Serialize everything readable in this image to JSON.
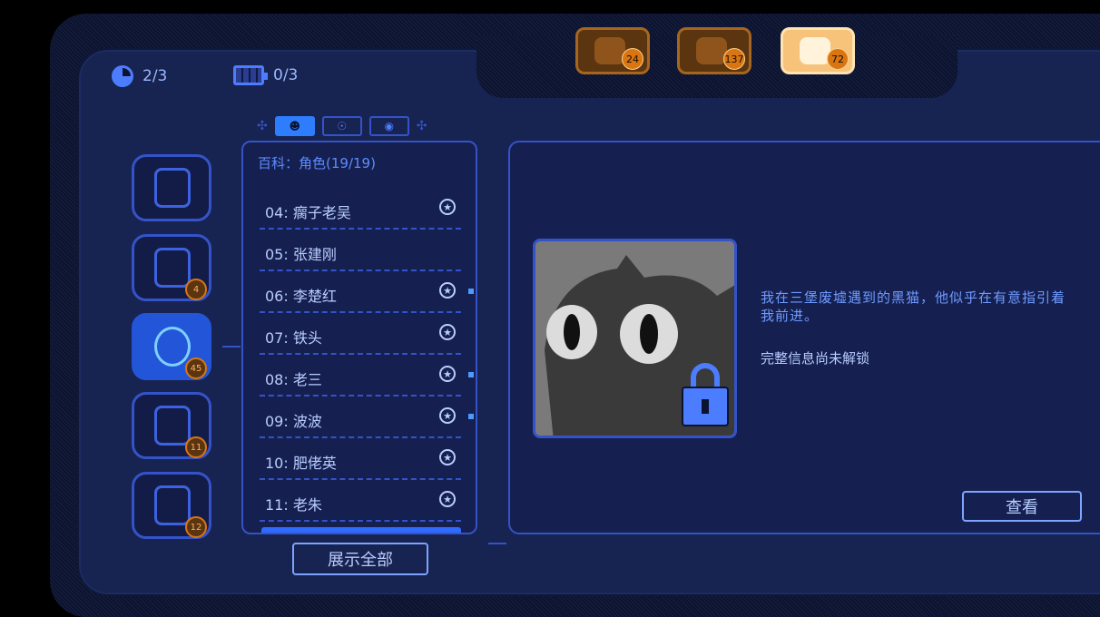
{
  "status": {
    "moves": "2/3",
    "battery": "0/3"
  },
  "top_tabs": [
    {
      "name": "tab-bolt",
      "badge": "24",
      "active": false
    },
    {
      "name": "tab-flag",
      "badge": "137",
      "active": false
    },
    {
      "name": "tab-chef",
      "badge": "72",
      "active": true
    }
  ],
  "side_badges": {
    "gallery": "4",
    "world": "45",
    "tasks": "11",
    "ideas": "12"
  },
  "list": {
    "title": "百科：角色(19/19)",
    "items": [
      {
        "label": "04: 瘸子老吴",
        "star": true,
        "dot": false
      },
      {
        "label": "05: 张建刚",
        "star": false,
        "dot": false
      },
      {
        "label": "06: 李楚红",
        "star": true,
        "dot": true
      },
      {
        "label": "07: 铁头",
        "star": true,
        "dot": false
      },
      {
        "label": "08: 老三",
        "star": true,
        "dot": true
      },
      {
        "label": "09: 波波",
        "star": true,
        "dot": true
      },
      {
        "label": "10: 肥佬英",
        "star": true,
        "dot": false
      },
      {
        "label": "11: 老朱",
        "star": true,
        "dot": false
      }
    ],
    "show_all": "展示全部"
  },
  "detail": {
    "description": "我在三堡废墟遇到的黑猫，他似乎在有意指引着我前进。",
    "locked_text": "完整信息尚未解锁",
    "view_button": "查看"
  },
  "colors": {
    "accent": "#2f6bff",
    "tab_active": "#f7c27a",
    "badge": "#d97612"
  }
}
